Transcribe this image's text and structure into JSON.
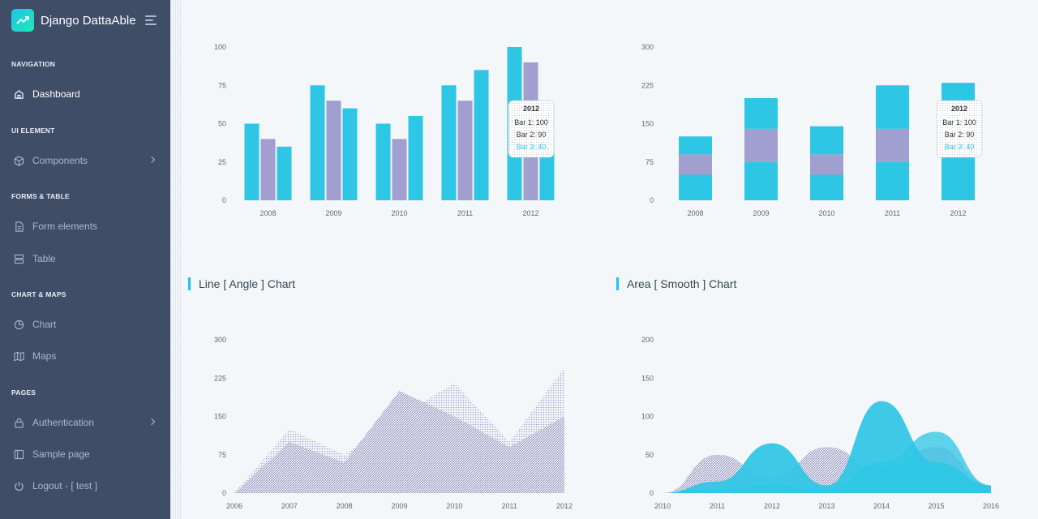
{
  "brand": {
    "title": "Django DattaAble"
  },
  "sidebar": {
    "captions": {
      "navigation": "NAVIGATION",
      "ui_element": "UI ELEMENT",
      "forms_table": "FORMS & TABLE",
      "chart_maps": "CHART & MAPS",
      "pages": "PAGES"
    },
    "items": [
      {
        "label": "Dashboard",
        "icon": "home-icon"
      },
      {
        "label": "Components",
        "icon": "box-icon"
      },
      {
        "label": "Form elements",
        "icon": "file-text-icon"
      },
      {
        "label": "Table",
        "icon": "server-icon"
      },
      {
        "label": "Chart",
        "icon": "pie-chart-icon"
      },
      {
        "label": "Maps",
        "icon": "map-icon"
      },
      {
        "label": "Authentication",
        "icon": "lock-icon"
      },
      {
        "label": "Sample page",
        "icon": "sidebar-icon"
      },
      {
        "label": "Logout - [ test ]",
        "icon": "power-icon"
      }
    ]
  },
  "cards": {
    "line_title": "Line [ Angle ] Chart",
    "area_title": "Area [ Smooth ] Chart"
  },
  "colors": {
    "cyan": "#2ec6e5",
    "lavender": "#a09fcf",
    "sidebar": "#3f4d67",
    "text": "#666666"
  },
  "chart_data": [
    {
      "type": "bar",
      "categories": [
        "2008",
        "2009",
        "2010",
        "2011",
        "2012"
      ],
      "series": [
        {
          "name": "Bar 1",
          "values": [
            50,
            75,
            50,
            75,
            100
          ]
        },
        {
          "name": "Bar 2",
          "values": [
            40,
            65,
            40,
            65,
            90
          ]
        },
        {
          "name": "Bar 3",
          "values": [
            35,
            60,
            55,
            85,
            40
          ]
        }
      ],
      "yticks": [
        "0",
        "25",
        "50",
        "75",
        "100"
      ],
      "ylim": [
        0,
        100
      ],
      "tooltip": {
        "title": "2012",
        "lines": [
          "Bar 1: 100",
          "Bar 2: 90",
          "Bar 3: 40"
        ]
      }
    },
    {
      "type": "bar",
      "stacked": true,
      "categories": [
        "2008",
        "2009",
        "2010",
        "2011",
        "2012"
      ],
      "series": [
        {
          "name": "Bar 1",
          "values": [
            50,
            75,
            50,
            75,
            100
          ]
        },
        {
          "name": "Bar 2",
          "values": [
            40,
            65,
            40,
            65,
            90
          ]
        },
        {
          "name": "Bar 3",
          "values": [
            35,
            60,
            55,
            85,
            40
          ]
        }
      ],
      "yticks": [
        "0",
        "75",
        "150",
        "225",
        "300"
      ],
      "ylim": [
        0,
        300
      ],
      "tooltip": {
        "title": "2012",
        "lines": [
          "Bar 1: 100",
          "Bar 2: 90",
          "Bar 3: 40"
        ]
      }
    },
    {
      "type": "area",
      "categories": [
        "2006",
        "2007",
        "2008",
        "2009",
        "2010",
        "2011",
        "2012"
      ],
      "series": [
        {
          "values": [
            0,
            100,
            60,
            200,
            150,
            90,
            150
          ]
        },
        {
          "values": [
            0,
            125,
            75,
            150,
            215,
            100,
            245
          ]
        }
      ],
      "yticks": [
        "0",
        "75",
        "150",
        "225",
        "300"
      ],
      "ylim": [
        0,
        300
      ]
    },
    {
      "type": "area",
      "smooth": true,
      "categories": [
        "2010",
        "2011",
        "2012",
        "2013",
        "2014",
        "2015",
        "2016"
      ],
      "series": [
        {
          "values": [
            0,
            50,
            20,
            60,
            30,
            60,
            10
          ]
        },
        {
          "values": [
            0,
            15,
            65,
            10,
            120,
            40,
            10
          ]
        },
        {
          "values": [
            0,
            5,
            10,
            5,
            40,
            80,
            10
          ]
        }
      ],
      "yticks": [
        "0",
        "50",
        "100",
        "150",
        "200"
      ],
      "ylim": [
        0,
        200
      ]
    }
  ]
}
